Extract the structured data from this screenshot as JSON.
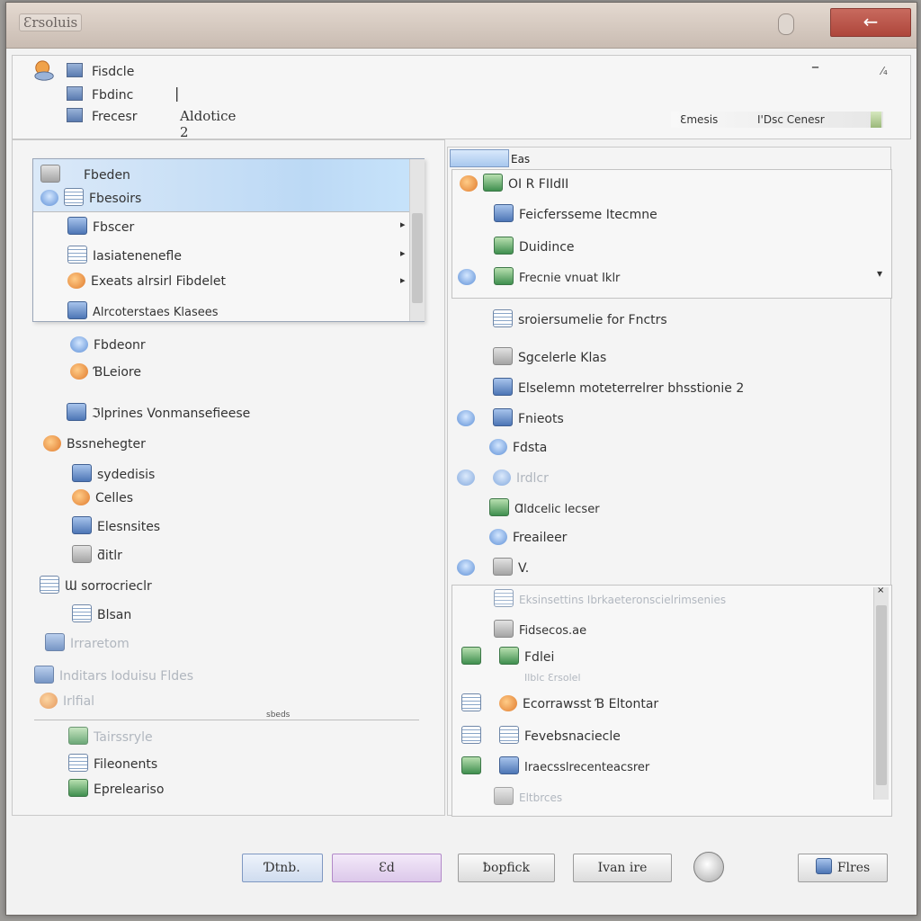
{
  "window": {
    "title": "Ɛrsoluis",
    "close_glyph": "←"
  },
  "header": {
    "rows": [
      "Fisdcle",
      "Fbdinc",
      "Frecesr"
    ],
    "cursor": "|",
    "field_value": "Aldotice 2",
    "right_label": "Ɛmesis",
    "right_value": "I'Dsc Cenesr",
    "dash": "–",
    "x_glyph": "⁄₄"
  },
  "left": {
    "menu": {
      "items": [
        "Fbeden",
        "Fbesoirs",
        "Fbscer",
        "Iasiatenenefle",
        "Exeats alrsirl Fibdelet",
        "Alrcoterstaes Klasees"
      ],
      "arrow": "▸"
    },
    "tree": [
      "Fbdeonr",
      "ƁLeiore",
      "ℑlprines Vonmansefieese",
      "Bssnehegter",
      "sydedisis",
      "Celles",
      "Elesnsites",
      "ƌitlr",
      "Ɯ sorrocrieclr",
      "Blsan",
      "Irraretom",
      "Inditars Ioduisu Fldes",
      "Irlfial",
      "Tairssryle",
      "Fileonents",
      "Epreleariso"
    ],
    "scroll_label": "sbeds"
  },
  "right": {
    "tab_label": "Eas",
    "items": [
      "OI R FIIdII",
      "Feicfersseme Itecmne",
      "Duidince",
      "Frecnie vnuat Iklr",
      "sroiersumelie for Fnctrs",
      "Sgcelerle Klas",
      "Elselemn moteterrelrer bhsstionie 2",
      "Fnieots",
      "Fdsta",
      "Irdlcr",
      "Ɑldcelic lecser",
      "Freaileer",
      "V."
    ],
    "list2": [
      "Eksinsettins Ibrkaeteronscielrimsenies",
      "Fidsecos.ae",
      "Fdlei",
      "Ilblc Ɛrsolel",
      "Ecorrawsst Ɓ Eltontar",
      "Fevebsnaciecle",
      "Iraecsslrecenteacsrer",
      "Eltbrces"
    ],
    "dropdown_arrow": "▾",
    "scroll_x": "×"
  },
  "buttons": {
    "b1": "Ɗtnb.",
    "b2": "Ɛd",
    "b3": "ƀopfick",
    "b4": "Ivan ire",
    "b5": "Flres"
  }
}
